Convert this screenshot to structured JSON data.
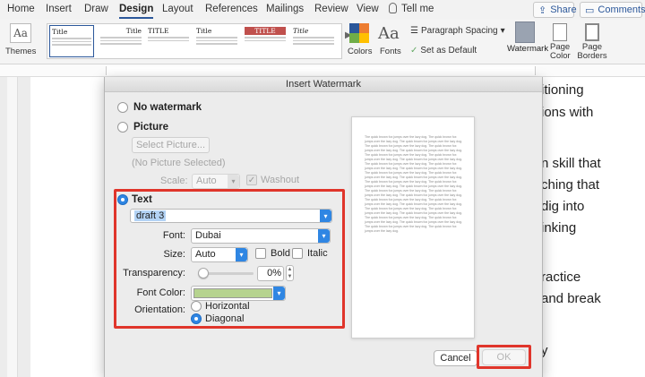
{
  "ribbon_tabs": [
    "Home",
    "Insert",
    "Draw",
    "Design",
    "Layout",
    "References",
    "Mailings",
    "Review",
    "View"
  ],
  "active_tab": "Design",
  "tell_me": "Tell me",
  "share_label": "Share",
  "comments_label": "Comments",
  "ribbon": {
    "themes_label": "Themes",
    "colors_label": "Colors",
    "fonts_label": "Fonts",
    "paragraph_spacing_label": "Paragraph Spacing",
    "set_as_default_label": "Set as Default",
    "watermark_label": "Watermark",
    "page_color_label": "Page Color",
    "page_borders_label": "Page Borders",
    "style_thumbnails": [
      "Title",
      "Title",
      "TITLE",
      "Title",
      "TITLE",
      "Title",
      "Title"
    ]
  },
  "document_lines": [
    "itioning",
    "ions with",
    "n skill that",
    "ching that",
    "dig into",
    "inking",
    "ractice",
    "and break",
    "y"
  ],
  "dialog": {
    "title": "Insert Watermark",
    "no_watermark_label": "No watermark",
    "picture_label": "Picture",
    "select_picture_label": "Select Picture...",
    "no_picture_label": "(No Picture Selected)",
    "scale_label": "Scale:",
    "scale_value": "Auto",
    "washout_label": "Washout",
    "text_label": "Text",
    "text_value": "draft 3",
    "font_label": "Font:",
    "font_value": "Dubai",
    "size_label": "Size:",
    "size_value": "Auto",
    "bold_label": "Bold",
    "italic_label": "Italic",
    "transparency_label": "Transparency:",
    "transparency_value": "0%",
    "transparency_fraction": 0,
    "font_color_label": "Font Color:",
    "font_color": "#b6d38f",
    "orientation_label": "Orientation:",
    "horizontal_label": "Horizontal",
    "diagonal_label": "Diagonal",
    "selected_orientation": "Diagonal",
    "selected_option": "Text",
    "preview_text": "The quick brown fox jumps over the lazy dog. The quick brown fox jumps over the lazy dog. The quick brown fox jumps over the lazy dog. The quick brown fox jumps over the lazy dog. The quick brown fox jumps over the lazy dog. The quick brown fox jumps over the lazy dog. The quick brown fox jumps over the lazy dog. The quick brown fox jumps over the lazy dog. The quick brown fox jumps over the lazy dog. The quick brown fox jumps over the lazy dog. The quick brown fox jumps over the lazy dog. The quick brown fox jumps over the lazy dog. The quick brown fox jumps over the lazy dog. The quick brown fox jumps over the lazy dog. The quick brown fox jumps over the lazy dog. The quick brown fox jumps over the lazy dog. The quick brown fox jumps over the lazy dog. The quick brown fox jumps over the lazy dog. The quick brown fox jumps over the lazy dog. The quick brown fox jumps over the lazy dog. The quick brown fox jumps over the lazy dog. The quick brown fox jumps over the lazy dog. The quick brown fox jumps over the lazy dog. The quick brown fox jumps over the lazy dog. The quick brown fox jumps over the lazy dog. The quick brown fox jumps over the lazy dog. The quick brown fox jumps over the lazy dog. The quick brown fox jumps over the lazy dog. The quick brown fox jumps over the lazy dog. The quick brown fox jumps over the lazy dog. The quick brown fox jumps over the lazy dog. The quick brown fox jumps over the lazy dog.",
    "cancel_label": "Cancel",
    "ok_label": "OK"
  },
  "colors": {
    "accent": "#2b579a",
    "highlight_red": "#e0352b",
    "macos_blue": "#2f86e3"
  }
}
